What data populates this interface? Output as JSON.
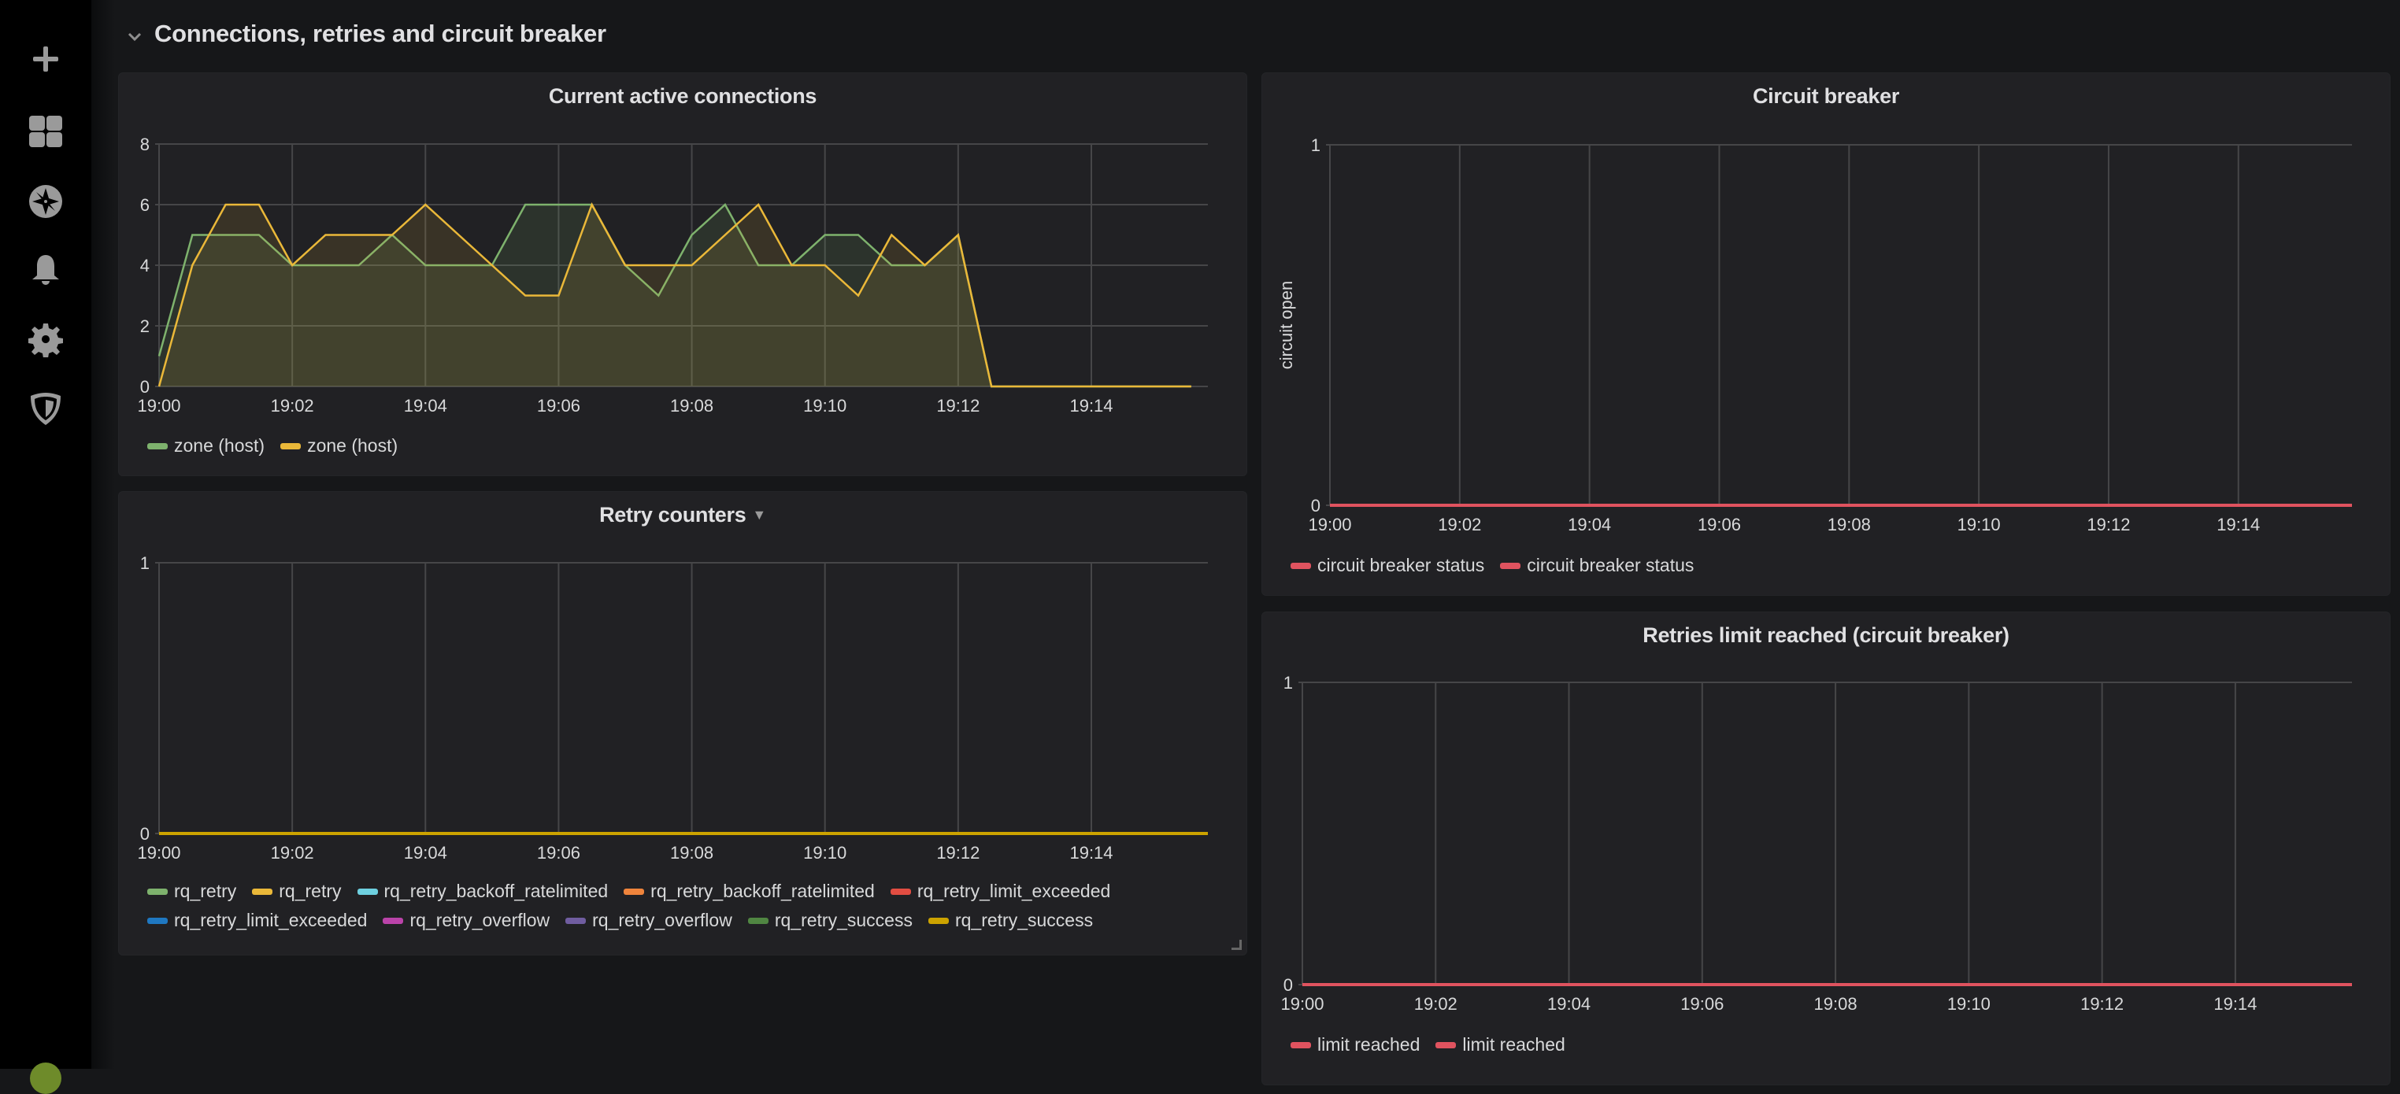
{
  "sidebar": {
    "items": [
      {
        "icon": "plus-icon",
        "label": "Create"
      },
      {
        "icon": "dashboards-icon",
        "label": "Dashboards"
      },
      {
        "icon": "explore-compass-icon",
        "label": "Explore"
      },
      {
        "icon": "alerting-bell-icon",
        "label": "Alerting"
      },
      {
        "icon": "configuration-gear-icon",
        "label": "Configuration"
      },
      {
        "icon": "server-admin-shield-icon",
        "label": "Server Admin"
      }
    ]
  },
  "row": {
    "title": "Connections, retries and circuit breaker",
    "collapsed": false
  },
  "colors": {
    "green": "#7eb26d",
    "yellow": "#eab839",
    "red": "#e24d42",
    "cb_red": "#e0535f",
    "grid": "#464648",
    "panel_bg": "#212124",
    "page_bg": "#161719"
  },
  "chart_data": [
    {
      "id": "active-connections",
      "type": "area",
      "title": "Current active connections",
      "xlabel": "",
      "ylabel": "",
      "x_ticks": [
        "19:00",
        "19:02",
        "19:04",
        "19:06",
        "19:08",
        "19:10",
        "19:12",
        "19:14"
      ],
      "y_ticks": [
        "0",
        "2",
        "4",
        "6",
        "8"
      ],
      "ylim": [
        0,
        8
      ],
      "xlim_minutes": [
        0,
        15.75
      ],
      "grid": true,
      "legend_position": "bottom-left",
      "x_minutes": [
        0,
        0.5,
        1,
        1.5,
        2,
        2.5,
        3,
        3.5,
        4,
        4.5,
        5,
        5.5,
        6,
        6.5,
        7,
        7.5,
        8,
        8.5,
        9,
        9.5,
        10,
        10.5,
        11,
        11.5,
        12,
        12.5,
        13,
        13.5,
        14,
        14.5,
        15,
        15.5
      ],
      "series": [
        {
          "name": "zone (host)",
          "color": "#7eb26d",
          "values": [
            1,
            5,
            5,
            5,
            4,
            4,
            4,
            5,
            4,
            4,
            4,
            6,
            6,
            6,
            4,
            3,
            5,
            6,
            4,
            4,
            5,
            5,
            4,
            4,
            5,
            0,
            0,
            0,
            0,
            0,
            0,
            0
          ]
        },
        {
          "name": "zone (host)",
          "color": "#eab839",
          "values": [
            0,
            4,
            6,
            6,
            4,
            5,
            5,
            5,
            6,
            5,
            4,
            3,
            3,
            6,
            4,
            4,
            4,
            5,
            6,
            4,
            4,
            3,
            5,
            4,
            5,
            0,
            0,
            0,
            0,
            0,
            0,
            0
          ]
        }
      ]
    },
    {
      "id": "retry-counters",
      "type": "line",
      "title": "Retry counters",
      "title_has_menu": true,
      "xlabel": "",
      "ylabel": "",
      "x_ticks": [
        "19:00",
        "19:02",
        "19:04",
        "19:06",
        "19:08",
        "19:10",
        "19:12",
        "19:14"
      ],
      "y_ticks": [
        "0",
        "1"
      ],
      "ylim": [
        0,
        1
      ],
      "xlim_minutes": [
        0,
        15.75
      ],
      "grid": true,
      "legend_position": "bottom-left",
      "x_minutes": [
        0,
        15.75
      ],
      "series": [
        {
          "name": "rq_retry",
          "color": "#7eb26d",
          "values": [
            0,
            0
          ]
        },
        {
          "name": "rq_retry",
          "color": "#eab839",
          "values": [
            0,
            0
          ]
        },
        {
          "name": "rq_retry_backoff_ratelimited",
          "color": "#6ed0e0",
          "values": [
            0,
            0
          ]
        },
        {
          "name": "rq_retry_backoff_ratelimited",
          "color": "#ef843c",
          "values": [
            0,
            0
          ]
        },
        {
          "name": "rq_retry_limit_exceeded",
          "color": "#e24d42",
          "values": [
            0,
            0
          ]
        },
        {
          "name": "rq_retry_limit_exceeded",
          "color": "#1f78c1",
          "values": [
            0,
            0
          ]
        },
        {
          "name": "rq_retry_overflow",
          "color": "#ba43a9",
          "values": [
            0,
            0
          ]
        },
        {
          "name": "rq_retry_overflow",
          "color": "#705da0",
          "values": [
            0,
            0
          ]
        },
        {
          "name": "rq_retry_success",
          "color": "#508642",
          "values": [
            0,
            0
          ]
        },
        {
          "name": "rq_retry_success",
          "color": "#cca300",
          "values": [
            0,
            0
          ]
        }
      ]
    },
    {
      "id": "circuit-breaker",
      "type": "line",
      "title": "Circuit breaker",
      "xlabel": "",
      "ylabel": "circuit open",
      "x_ticks": [
        "19:00",
        "19:02",
        "19:04",
        "19:06",
        "19:08",
        "19:10",
        "19:12",
        "19:14"
      ],
      "y_ticks": [
        "0",
        "1"
      ],
      "ylim": [
        0,
        1
      ],
      "xlim_minutes": [
        0,
        15.75
      ],
      "grid": true,
      "legend_position": "bottom-left",
      "x_minutes": [
        0,
        15.75
      ],
      "series": [
        {
          "name": "circuit breaker status",
          "color": "#e0535f",
          "values": [
            0,
            0
          ]
        },
        {
          "name": "circuit breaker status",
          "color": "#e0535f",
          "values": [
            0,
            0
          ]
        }
      ]
    },
    {
      "id": "retries-limit-reached",
      "type": "line",
      "title": "Retries limit reached (circuit breaker)",
      "xlabel": "",
      "ylabel": "",
      "x_ticks": [
        "19:00",
        "19:02",
        "19:04",
        "19:06",
        "19:08",
        "19:10",
        "19:12",
        "19:14"
      ],
      "y_ticks": [
        "0",
        "1"
      ],
      "ylim": [
        0,
        1
      ],
      "xlim_minutes": [
        0,
        15.75
      ],
      "grid": true,
      "legend_position": "bottom-left",
      "x_minutes": [
        0,
        15.75
      ],
      "series": [
        {
          "name": "limit reached",
          "color": "#e0535f",
          "values": [
            0,
            0
          ]
        },
        {
          "name": "limit reached",
          "color": "#e0535f",
          "values": [
            0,
            0
          ]
        }
      ]
    }
  ]
}
